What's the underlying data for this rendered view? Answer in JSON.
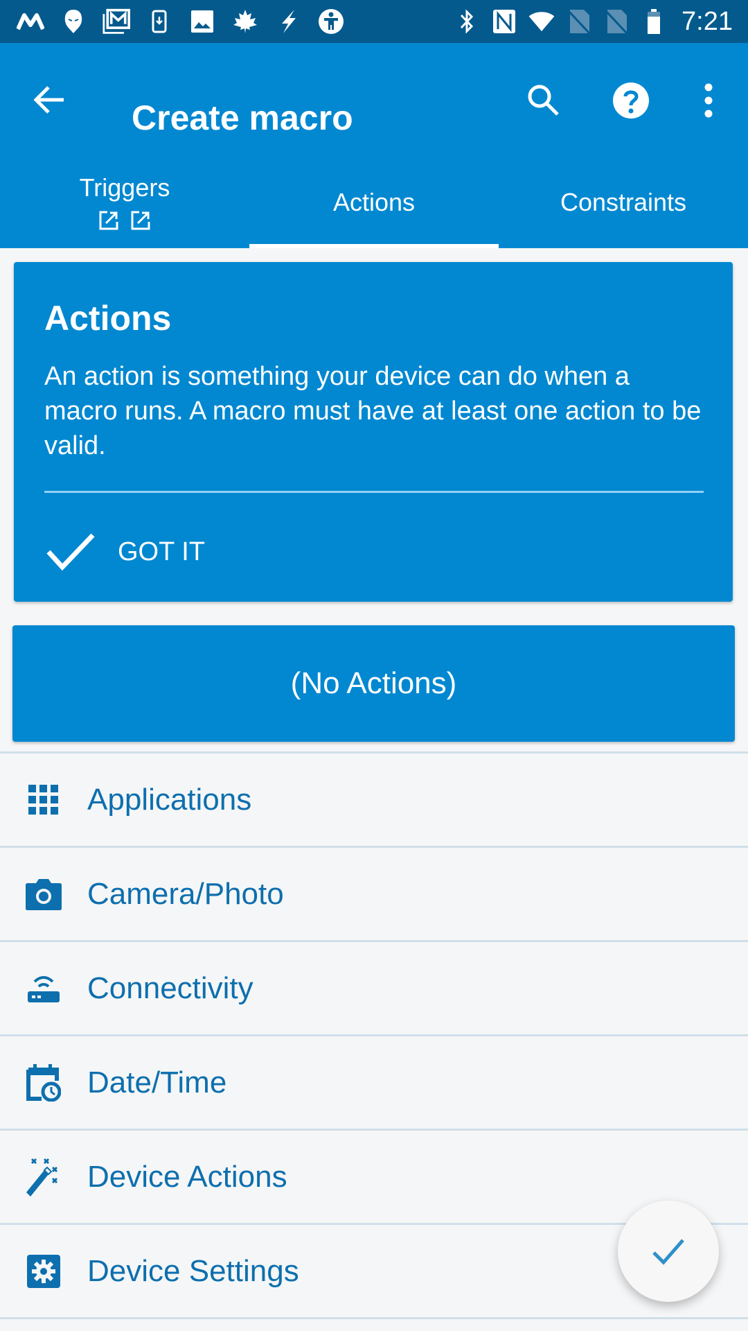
{
  "status_bar": {
    "left_icons": [
      "m-logo-icon",
      "mask-icon",
      "gmail-icon",
      "phone-download-icon",
      "image-icon",
      "maple-leaf-icon",
      "lightning-icon",
      "accessibility-icon"
    ],
    "right_icons": [
      "bluetooth-icon",
      "nfc-icon",
      "wifi-icon",
      "no-sim-icon",
      "no-sim-icon",
      "battery-icon"
    ],
    "time": "7:21"
  },
  "app_bar": {
    "title": "Create macro",
    "actions": [
      "search-icon",
      "help-icon",
      "more-vert-icon"
    ]
  },
  "tabs": [
    {
      "label": "Triggers",
      "sub_icons": [
        "open-external-icon",
        "open-external-icon"
      ],
      "selected": false
    },
    {
      "label": "Actions",
      "selected": true
    },
    {
      "label": "Constraints",
      "selected": false
    }
  ],
  "info_card": {
    "title": "Actions",
    "body": "An action is something your device can do when a macro runs. A macro must have at least one action to be valid.",
    "button_label": "GOT IT"
  },
  "actions_summary": {
    "label": "(No Actions)"
  },
  "categories": [
    {
      "label": "Applications",
      "icon": "apps-grid-icon"
    },
    {
      "label": "Camera/Photo",
      "icon": "camera-icon"
    },
    {
      "label": "Connectivity",
      "icon": "router-icon"
    },
    {
      "label": "Date/Time",
      "icon": "calendar-clock-icon"
    },
    {
      "label": "Device Actions",
      "icon": "magic-wand-icon"
    },
    {
      "label": "Device Settings",
      "icon": "settings-box-icon"
    }
  ],
  "fab": {
    "icon": "check-icon"
  },
  "colors": {
    "status_bar": "#045a8d",
    "primary": "#0288d1",
    "list_text": "#0d6fae",
    "background": "#f5f6f7"
  }
}
